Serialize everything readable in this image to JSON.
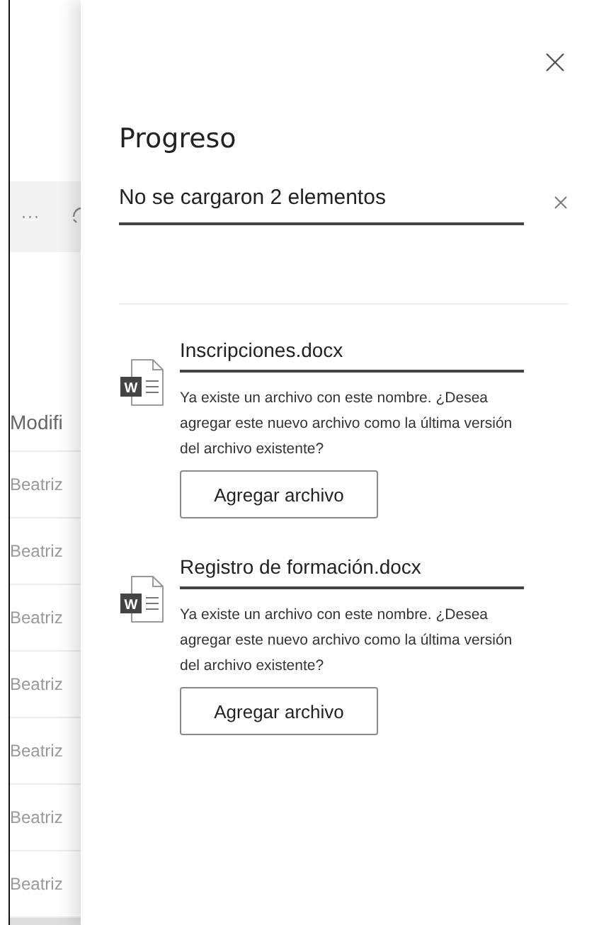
{
  "background": {
    "toolbar": {
      "more": "···"
    },
    "column_header": "Modifi",
    "rows": [
      "Beatriz",
      "Beatriz",
      "Beatriz",
      "Beatriz",
      "Beatriz",
      "Beatriz",
      "Beatriz"
    ]
  },
  "panel": {
    "title": "Progreso",
    "status": "No se cargaron 2 elementos",
    "items": [
      {
        "name": "Inscripciones.docx",
        "icon_letter": "W",
        "message": "Ya existe un archivo con este nombre. ¿Desea agregar este nuevo archivo como la última versión del archivo existente?",
        "button": "Agregar archivo"
      },
      {
        "name": "Registro de formación.docx",
        "icon_letter": "W",
        "message": "Ya existe un archivo con este nombre. ¿Desea agregar este nuevo archivo como la última versión del archivo existente?",
        "button": "Agregar archivo"
      }
    ]
  }
}
